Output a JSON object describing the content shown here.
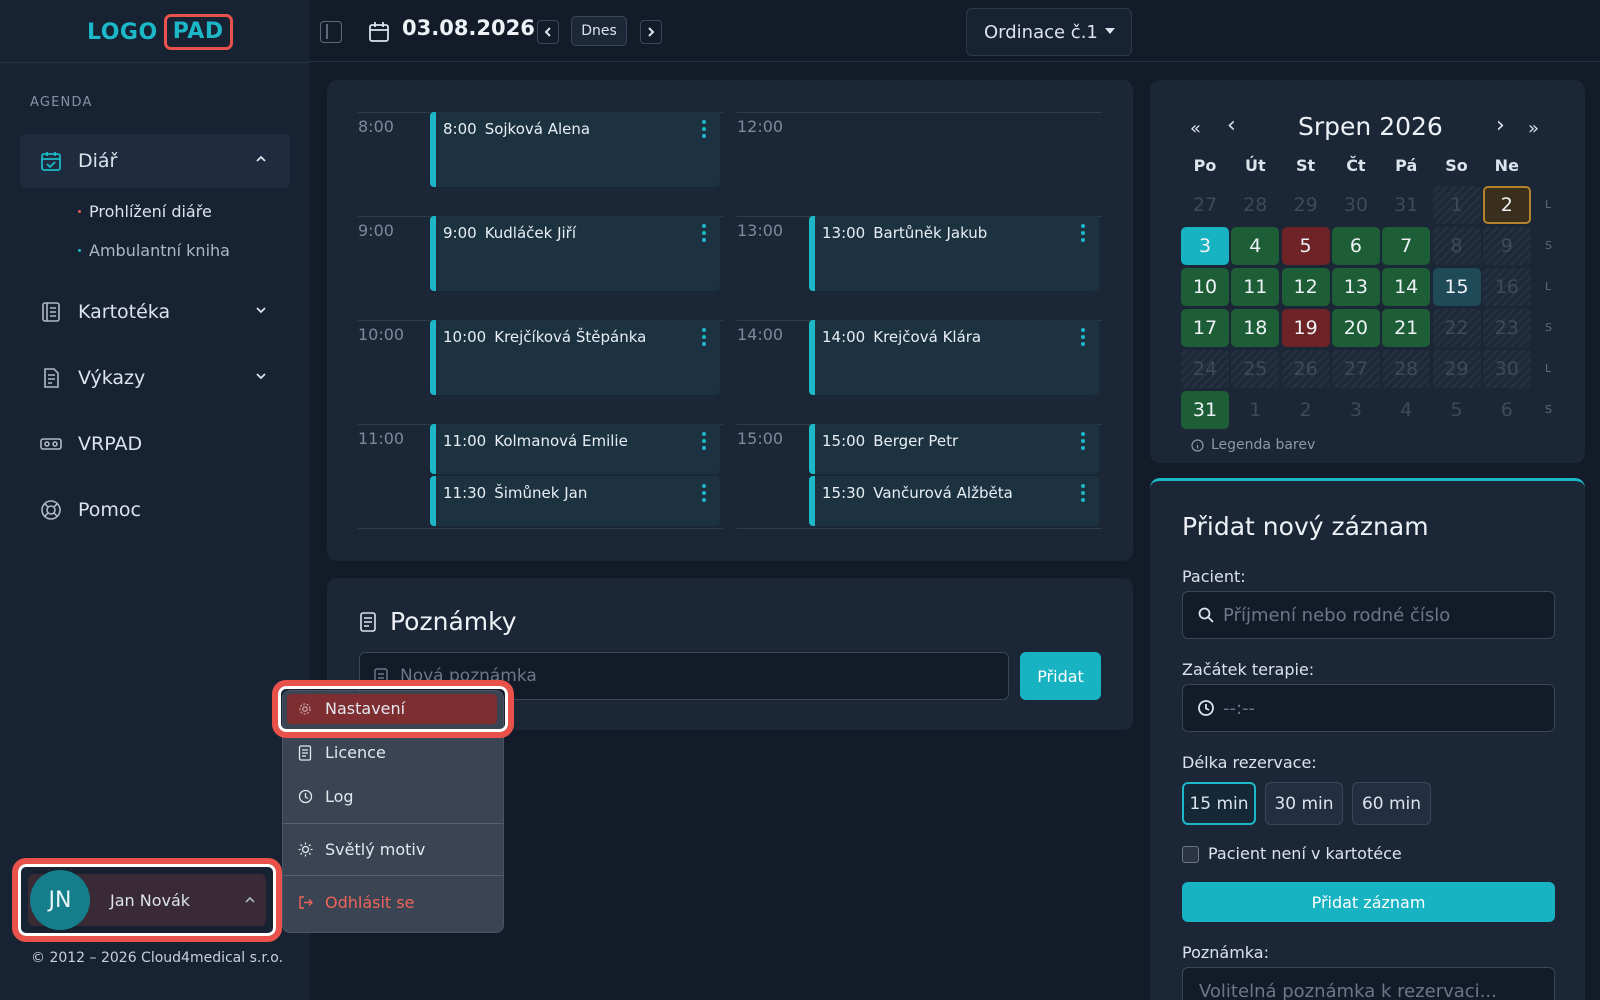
{
  "brand": {
    "logo_left": "LOGO",
    "logo_right": "PAD",
    "accent": "#1cb8c8",
    "danger": "#e8524a"
  },
  "sidebar": {
    "section_title": "AGENDA",
    "items": [
      {
        "label": "Diář",
        "icon": "calendar-check-icon"
      },
      {
        "label": "Kartotéka",
        "icon": "card-file-icon"
      },
      {
        "label": "Výkazy",
        "icon": "report-icon"
      },
      {
        "label": "VRPAD",
        "icon": "vr-headset-icon"
      },
      {
        "label": "Pomoc",
        "icon": "lifebuoy-icon"
      }
    ],
    "sub_items": [
      "Prohlížení diáře",
      "Ambulantní kniha"
    ]
  },
  "user": {
    "initials": "JN",
    "name": "Jan Novák"
  },
  "copyright": "© 2012 – 2026 Cloud4medical s.r.o.",
  "topbar": {
    "date": "03.08.2026",
    "today_label": "Dnes",
    "office": "Ordinace č.1"
  },
  "schedule": {
    "times_left": [
      "8:00",
      "9:00",
      "10:00",
      "11:00"
    ],
    "times_right": [
      "12:00",
      "13:00",
      "14:00",
      "15:00"
    ],
    "appointments": [
      {
        "time": "8:00",
        "name": "Sojková Alena"
      },
      {
        "time": "9:00",
        "name": "Kudláček Jiří"
      },
      {
        "time": "10:00",
        "name": "Krejčíková Štěpánka"
      },
      {
        "time": "11:00",
        "name": "Kolmanová Emilie"
      },
      {
        "time": "11:30",
        "name": "Šimůnek Jan"
      },
      {
        "time": "13:00",
        "name": "Bartůněk Jakub"
      },
      {
        "time": "14:00",
        "name": "Krejčová Klára"
      },
      {
        "time": "15:00",
        "name": "Berger Petr"
      },
      {
        "time": "15:30",
        "name": "Vančurová Alžběta"
      }
    ]
  },
  "notes": {
    "title": "Poznámky",
    "placeholder": "Nová poznámka",
    "add_label": "Přidat"
  },
  "user_menu": {
    "items": [
      "Nastavení",
      "Licence",
      "Log",
      "Světlý motiv",
      "Odhlásit se"
    ]
  },
  "calendar": {
    "nav": {
      "first": "«",
      "prev": "‹",
      "next": "›",
      "last": "»"
    },
    "title": "Srpen 2026",
    "weekdays": [
      "Po",
      "Út",
      "St",
      "Čt",
      "Pá",
      "So",
      "Ne"
    ],
    "week_marks": [
      "L",
      "S",
      "L",
      "S",
      "L",
      "S"
    ],
    "weeks": [
      [
        {
          "d": "27",
          "s": "out"
        },
        {
          "d": "28",
          "s": "out"
        },
        {
          "d": "29",
          "s": "out"
        },
        {
          "d": "30",
          "s": "out"
        },
        {
          "d": "31",
          "s": "out"
        },
        {
          "d": "1",
          "s": "weekend"
        },
        {
          "d": "2",
          "s": "highlight"
        }
      ],
      [
        {
          "d": "3",
          "s": "today"
        },
        {
          "d": "4",
          "s": "green"
        },
        {
          "d": "5",
          "s": "red"
        },
        {
          "d": "6",
          "s": "green"
        },
        {
          "d": "7",
          "s": "green"
        },
        {
          "d": "8",
          "s": "weekend"
        },
        {
          "d": "9",
          "s": "weekend"
        }
      ],
      [
        {
          "d": "10",
          "s": "green"
        },
        {
          "d": "11",
          "s": "green"
        },
        {
          "d": "12",
          "s": "green"
        },
        {
          "d": "13",
          "s": "green"
        },
        {
          "d": "14",
          "s": "green"
        },
        {
          "d": "15",
          "s": "teal"
        },
        {
          "d": "16",
          "s": "weekend"
        }
      ],
      [
        {
          "d": "17",
          "s": "green"
        },
        {
          "d": "18",
          "s": "green"
        },
        {
          "d": "19",
          "s": "red"
        },
        {
          "d": "20",
          "s": "green"
        },
        {
          "d": "21",
          "s": "green"
        },
        {
          "d": "22",
          "s": "weekend"
        },
        {
          "d": "23",
          "s": "weekend"
        }
      ],
      [
        {
          "d": "24",
          "s": "weekend"
        },
        {
          "d": "25",
          "s": "weekend"
        },
        {
          "d": "26",
          "s": "weekend"
        },
        {
          "d": "27",
          "s": "weekend"
        },
        {
          "d": "28",
          "s": "weekend"
        },
        {
          "d": "29",
          "s": "weekend"
        },
        {
          "d": "30",
          "s": "weekend"
        }
      ],
      [
        {
          "d": "31",
          "s": "green"
        },
        {
          "d": "1",
          "s": "out"
        },
        {
          "d": "2",
          "s": "out"
        },
        {
          "d": "3",
          "s": "out"
        },
        {
          "d": "4",
          "s": "out"
        },
        {
          "d": "5",
          "s": "out"
        },
        {
          "d": "6",
          "s": "out"
        }
      ]
    ],
    "legend": "Legenda barev"
  },
  "form": {
    "title": "Přidat nový záznam",
    "patient_label": "Pacient:",
    "patient_placeholder": "Příjmení nebo rodné číslo",
    "start_label": "Začátek terapie:",
    "start_placeholder": "--:--",
    "duration_label": "Délka rezervace:",
    "durations": [
      "15 min",
      "30 min",
      "60 min"
    ],
    "selected_duration": "15 min",
    "not_in_registry_label": "Pacient není v kartotéce",
    "submit_label": "Přidat záznam",
    "note_label": "Poznámka:",
    "note_placeholder": "Volitelná poznámka k rezervaci..."
  }
}
